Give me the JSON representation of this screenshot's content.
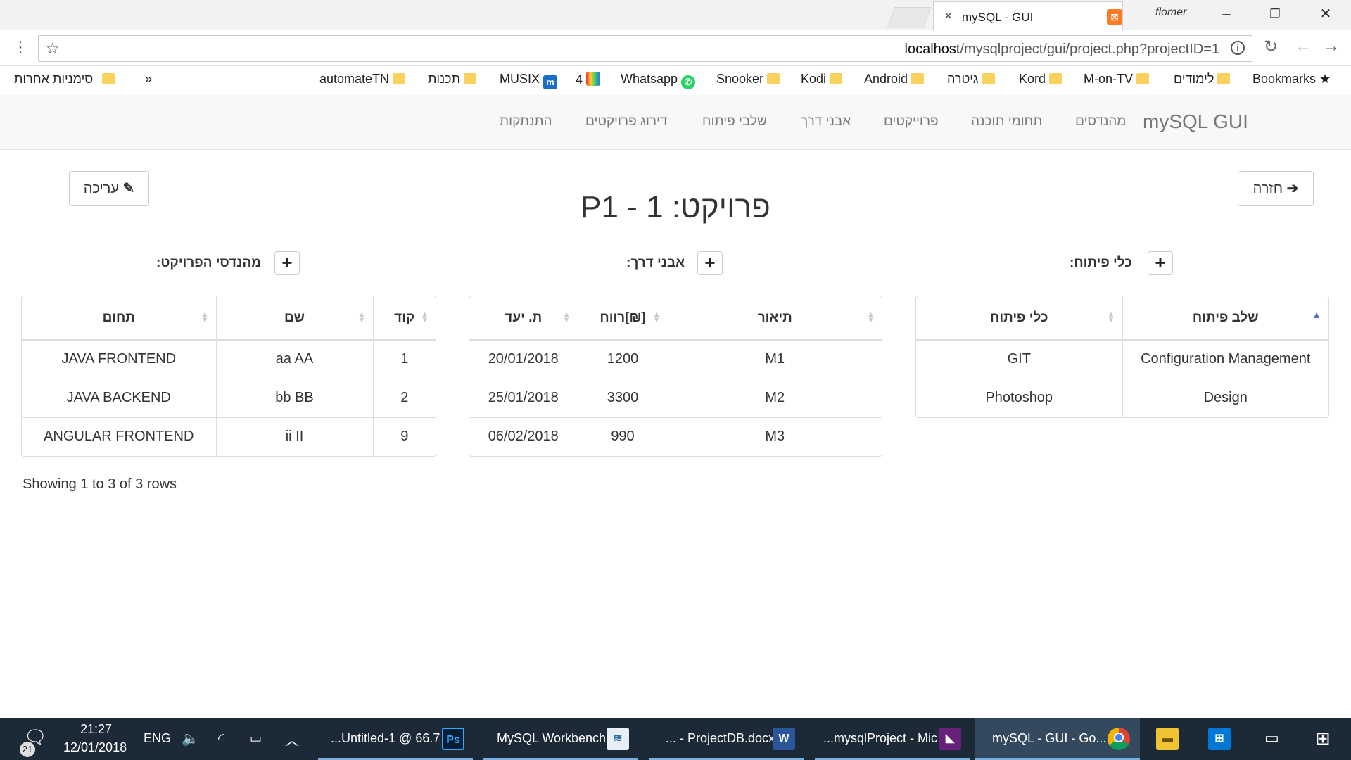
{
  "browser": {
    "tab_title": "mySQL - GUI",
    "tab_favicon": "xampp-icon",
    "profile_name": "flomer",
    "url_host": "localhost",
    "url_path": "/mysqlproject/gui/project.php?projectID=1",
    "bookmarks": [
      {
        "label": "Bookmarks",
        "icon": "star-icon"
      },
      {
        "label": "לימודים",
        "icon": "folder-icon"
      },
      {
        "label": "M-on-TV",
        "icon": "folder-icon"
      },
      {
        "label": "Kord",
        "icon": "folder-icon"
      },
      {
        "label": "גיטרה",
        "icon": "folder-icon"
      },
      {
        "label": "Android",
        "icon": "folder-icon"
      },
      {
        "label": "Kodi",
        "icon": "folder-icon"
      },
      {
        "label": "Snooker",
        "icon": "folder-icon"
      },
      {
        "label": "Whatsapp",
        "icon": "whatsapp-icon"
      },
      {
        "label": "4",
        "icon": "tv-icon"
      },
      {
        "label": "MUSIX",
        "icon": "musix-icon"
      },
      {
        "label": "תכנות",
        "icon": "folder-icon"
      },
      {
        "label": "automateTN",
        "icon": "folder-icon"
      },
      {
        "label": "»",
        "icon": ""
      },
      {
        "label": "סימניות אחרות",
        "icon": "folder-icon"
      }
    ]
  },
  "app": {
    "brand": "mySQL GUI",
    "nav": [
      "מהנדסים",
      "תחומי תוכנה",
      "פרוייקטים",
      "אבני דרך",
      "שלבי פיתוח",
      "דירוג פרויקטים",
      "התנתקות"
    ],
    "back_label": "חזרה",
    "edit_label": "עריכה",
    "page_title": "פרויקט: 1 - P1"
  },
  "tools_section": {
    "label": "כלי פיתוח:",
    "columns": [
      "שלב פיתוח",
      "כלי פיתוח"
    ],
    "rows": [
      [
        "Configuration Management",
        "GIT"
      ],
      [
        "Design",
        "Photoshop"
      ]
    ]
  },
  "milestones_section": {
    "label": "אבני דרך:",
    "columns": [
      "תיאור",
      "רווח[₪]",
      "ת. יעד"
    ],
    "rows": [
      [
        "M1",
        "1200",
        "20/01/2018"
      ],
      [
        "M2",
        "3300",
        "25/01/2018"
      ],
      [
        "M3",
        "990",
        "06/02/2018"
      ]
    ]
  },
  "engineers_section": {
    "label": "מהנדסי הפרויקט:",
    "columns": [
      "קוד",
      "שם",
      "תחום"
    ],
    "rows": [
      [
        "1",
        "aa AA",
        "JAVA FRONTEND"
      ],
      [
        "2",
        "bb BB",
        "JAVA BACKEND"
      ],
      [
        "9",
        "ii II",
        "ANGULAR FRONTEND"
      ]
    ]
  },
  "pagination_text": "Showing 1 to 3 of 3 rows",
  "taskbar": {
    "clock_time": "21:27",
    "clock_date": "12/01/2018",
    "language": "ENG",
    "notification_count": "21",
    "apps": [
      {
        "label": "...Untitled-1 @ 66.7",
        "icon": "photoshop-icon"
      },
      {
        "label": "MySQL Workbench",
        "icon": "mysql-workbench-icon"
      },
      {
        "label": "... - ProjectDB.docx",
        "icon": "word-icon"
      },
      {
        "label": "...mysqlProject - Mic",
        "icon": "visual-studio-icon"
      },
      {
        "label": "mySQL - GUI - Go...",
        "icon": "chrome-icon"
      }
    ]
  },
  "colors": {
    "navbar_bg": "#f8f8f8",
    "taskbar_bg": "#1c2a38",
    "sort_active": "#4a69c8"
  }
}
